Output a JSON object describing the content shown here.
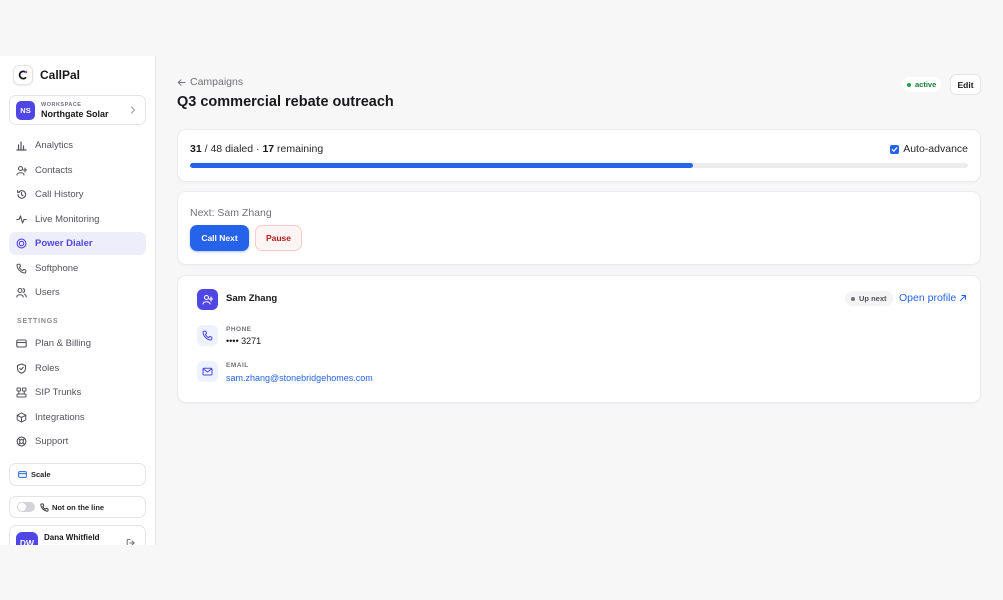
{
  "app": {
    "name": "CallPal"
  },
  "workspace": {
    "label": "WORKSPACE",
    "initials": "NS",
    "name": "Northgate Solar"
  },
  "sidebar": {
    "items": [
      {
        "label": "Analytics",
        "icon": "bar-chart-icon"
      },
      {
        "label": "Contacts",
        "icon": "user-plus-icon"
      },
      {
        "label": "Call History",
        "icon": "history-icon"
      },
      {
        "label": "Live Monitoring",
        "icon": "activity-icon"
      },
      {
        "label": "Power Dialer",
        "icon": "target-icon",
        "active": true
      },
      {
        "label": "Softphone",
        "icon": "phone-icon"
      },
      {
        "label": "Users",
        "icon": "users-icon"
      }
    ],
    "settings_label": "SETTINGS",
    "settings_items": [
      {
        "label": "Plan & Billing",
        "icon": "credit-card-icon"
      },
      {
        "label": "Roles",
        "icon": "shield-icon"
      },
      {
        "label": "SIP Trunks",
        "icon": "network-icon"
      },
      {
        "label": "Integrations",
        "icon": "box-icon"
      },
      {
        "label": "Support",
        "icon": "lifebuoy-icon"
      }
    ],
    "plan": "Scale",
    "line_status": "Not on the line",
    "user": {
      "initials": "DW",
      "name": "Dana Whitfield"
    }
  },
  "header": {
    "back_label": "Campaigns",
    "title": "Q3 commercial rebate outreach",
    "status": "active",
    "edit_label": "Edit"
  },
  "progress": {
    "dialed": "31",
    "total": "48",
    "dialed_suffix": "dialed",
    "remaining": "17",
    "remaining_suffix": "remaining",
    "fraction": 0.646,
    "auto_advance_label": "Auto-advance",
    "auto_advance": true
  },
  "next": {
    "label": "Next: Sam Zhang",
    "call_label": "Call Next",
    "pause_label": "Pause"
  },
  "contact": {
    "name": "Sam Zhang",
    "badge": "Up next",
    "open_profile": "Open profile",
    "phone_label": "PHONE",
    "phone": "•••• 3271",
    "email_label": "EMAIL",
    "email": "sam.zhang@stonebridgehomes.com"
  },
  "colors": {
    "accent": "#2563eb",
    "brand": "#4f46e5",
    "danger": "#b91c1c",
    "success": "#16a34a"
  }
}
